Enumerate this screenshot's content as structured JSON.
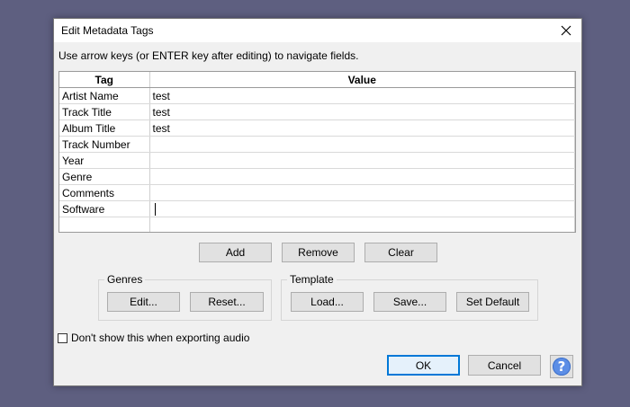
{
  "window": {
    "title": "Edit Metadata Tags",
    "close_icon": "close-icon"
  },
  "instructions": "Use arrow keys (or ENTER key after editing) to navigate fields.",
  "table": {
    "headers": [
      "Tag",
      "Value"
    ],
    "rows": [
      {
        "tag": "Artist Name",
        "value": "test"
      },
      {
        "tag": "Track Title",
        "value": "test"
      },
      {
        "tag": "Album Title",
        "value": "test"
      },
      {
        "tag": "Track Number",
        "value": ""
      },
      {
        "tag": "Year",
        "value": ""
      },
      {
        "tag": "Genre",
        "value": ""
      },
      {
        "tag": "Comments",
        "value": ""
      },
      {
        "tag": "Software",
        "value": ""
      },
      {
        "tag": "",
        "value": ""
      }
    ]
  },
  "row_buttons": {
    "add": "Add",
    "remove": "Remove",
    "clear": "Clear"
  },
  "genres": {
    "label": "Genres",
    "edit": "Edit...",
    "reset": "Reset..."
  },
  "template": {
    "label": "Template",
    "load": "Load...",
    "save": "Save...",
    "set_default": "Set Default"
  },
  "dont_show": {
    "label": "Don't show this when exporting audio",
    "checked": false
  },
  "footer": {
    "ok": "OK",
    "cancel": "Cancel",
    "help_icon": "help-icon",
    "help_glyph": "?"
  },
  "colors": {
    "desktop": "#5e5f80",
    "dialog_bg": "#f0f0f0",
    "focus_border": "#0078d7",
    "help_blue": "#5c8ee6"
  }
}
